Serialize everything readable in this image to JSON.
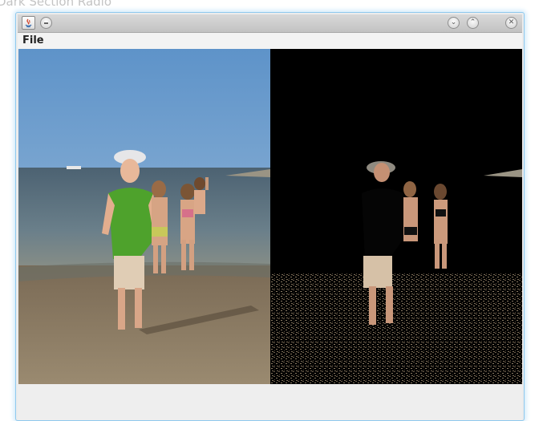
{
  "desktop_title": "Dark Section Radio",
  "window": {
    "app_icon": "java-icon",
    "title_buttons": [
      "menu-icon",
      "minimize-icon",
      "maximize-icon",
      "close-icon"
    ]
  },
  "menubar": {
    "items": [
      {
        "label": "File"
      }
    ]
  },
  "images": {
    "left": {
      "name": "original-photo",
      "description_icon": "beach-photo"
    },
    "right": {
      "name": "processed-photo",
      "description_icon": "dark-section-photo"
    }
  },
  "colors": {
    "window_border": "#8fc9ee",
    "titlebar": "#c8c8c8",
    "sky": "#6d9fd0",
    "sea": "#566a78",
    "sand": "#8f7f66",
    "shirt": "#4ea22c"
  }
}
